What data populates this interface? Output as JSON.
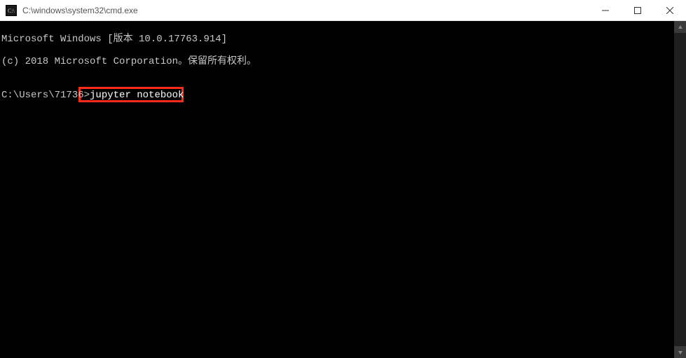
{
  "window": {
    "title": "C:\\windows\\system32\\cmd.exe"
  },
  "terminal": {
    "line1": "Microsoft Windows [版本 10.0.17763.914]",
    "line2": "(c) 2018 Microsoft Corporation。保留所有权利。",
    "blank": "",
    "prompt": "C:\\Users\\71736>",
    "command": "jupyter notebook"
  }
}
